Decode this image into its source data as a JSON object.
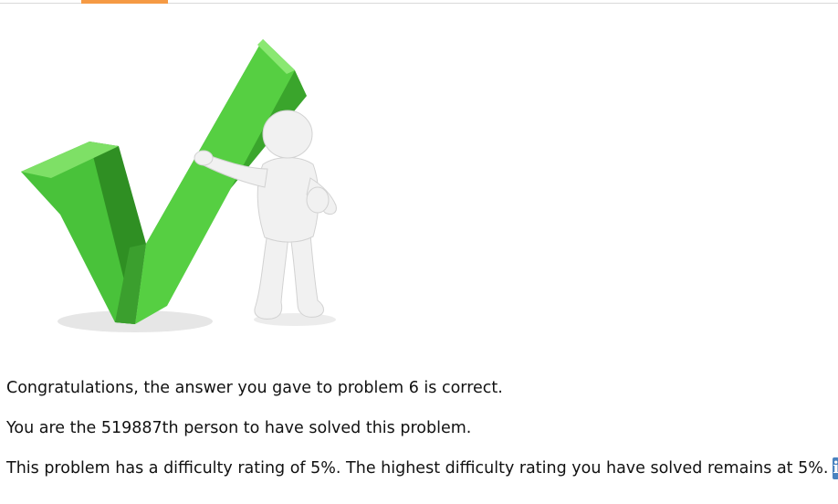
{
  "header": {
    "active_tab_color": "#f59a44"
  },
  "hero_image": {
    "icon": "checkmark-figure-icon",
    "check_color": "#45c236"
  },
  "messages": {
    "congratulations": "Congratulations, the answer you gave to problem 6 is correct.",
    "solver_count": "You are the 519887th person to have solved this problem.",
    "difficulty": "This problem has a difficulty rating of 5%. The highest difficulty rating you have solved remains at 5%."
  },
  "info_button": {
    "label": "i",
    "icon": "info-icon",
    "color": "#4a83c0"
  }
}
